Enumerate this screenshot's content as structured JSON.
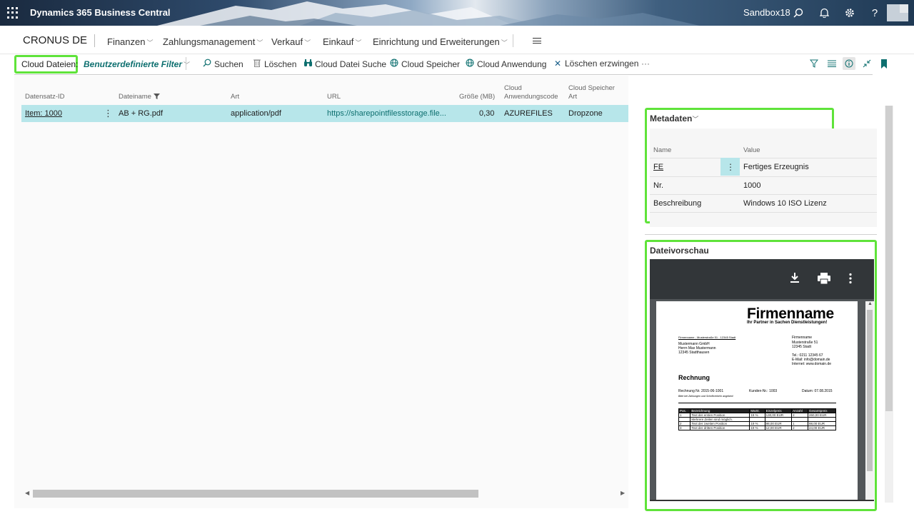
{
  "topbar": {
    "app_title": "Dynamics 365 Business Central",
    "environment": "Sandbox18",
    "icons": [
      "waffle-icon",
      "search-icon",
      "bell-icon",
      "gear-icon",
      "help-icon",
      "avatar"
    ]
  },
  "nav": {
    "company": "CRONUS DE",
    "items": [
      {
        "label": "Finanzen"
      },
      {
        "label": "Zahlungsmanagement"
      },
      {
        "label": "Verkauf"
      },
      {
        "label": "Einkauf"
      },
      {
        "label": "Einrichtung und Erweiterungen"
      }
    ]
  },
  "actionbar": {
    "title": "Cloud Dateien:",
    "filter": "Benutzerdefinierte Filter",
    "actions": [
      {
        "label": "Suchen",
        "icon": "search-icon"
      },
      {
        "label": "Löschen",
        "icon": "trash-icon"
      },
      {
        "label": "Cloud Datei Suche",
        "icon": "binoculars-icon"
      },
      {
        "label": "Cloud Speicher",
        "icon": "globe-icon"
      },
      {
        "label": "Cloud Anwendung",
        "icon": "globe-icon"
      },
      {
        "label": "Löschen erzwingen",
        "icon": "x-icon"
      }
    ],
    "more": "···"
  },
  "grid": {
    "columns": [
      {
        "label": "Datensatz-ID"
      },
      {
        "label": "Dateiname"
      },
      {
        "label": "Art"
      },
      {
        "label": "URL"
      },
      {
        "label": "Größe (MB)"
      },
      {
        "label": "Cloud\nAnwendungscode"
      },
      {
        "label": "Cloud Speicher\nArt"
      }
    ],
    "rows": [
      {
        "record_id": "Item: 1000",
        "filename": "AB + RG.pdf",
        "type": "application/pdf",
        "url": "https://sharepointfilesstorage.file...",
        "size": "0,30",
        "app_code": "AZUREFILES",
        "storage_type": "Dropzone"
      }
    ]
  },
  "metadata": {
    "title": "Metadaten",
    "headers": {
      "name": "Name",
      "value": "Value"
    },
    "rows": [
      {
        "name": "FE",
        "value": "Fertiges Erzeugnis"
      },
      {
        "name": "Nr.",
        "value": "1000"
      },
      {
        "name": "Beschreibung",
        "value": "Windows 10 ISO Lizenz"
      }
    ]
  },
  "preview": {
    "title": "Dateivorschau",
    "document": {
      "company": "Firmenname",
      "slogan": "Ihr Partner in Sachen Dienstleistungen!",
      "sender_line": "Firmenname - Musterstraße 51 - 12345 Stadt",
      "recipient": [
        "Mustermann GmbH",
        "Herrn Max Mustermann",
        "12345 Stadthausen"
      ],
      "company_block": [
        "Firmenname",
        "Musterstraße 51",
        "12345 Stadt",
        "",
        "Tel.: 0211 12345 67",
        "E-Mail: info@domain.de",
        "Internet: www.domain.de"
      ],
      "heading": "Rechnung",
      "invoice_no": "Rechnung Nr. 2015-06-1001",
      "customer_no": "Kunden-Nr.: 1003",
      "date": "Datum: 07.08.2015",
      "note": "Bitte bei Zahlungen und Schriftverkehr angeben!",
      "table_headers": [
        "Pos.",
        "Bezeichnung",
        "MwSt.",
        "Einzelpreis",
        "Anzahl",
        "Gesamtpreis"
      ],
      "table_rows": [
        [
          "1",
          "Text der ersten Position",
          "19 %",
          "130,00 EUR",
          "2",
          "260,00 EUR"
        ],
        [
          "",
          "Mehrere Zeilen sind möglich.",
          "",
          "",
          "",
          ""
        ],
        [
          "2",
          "Text der zweiten Position",
          "19 %",
          "98,00 EUR",
          "1",
          "98,00 EUR"
        ],
        [
          "3",
          "Text der dritten Position",
          "19 %",
          "12,00 EUR",
          "2",
          "24,00 EUR"
        ]
      ]
    }
  },
  "colors": {
    "accent": "#0d6f6f",
    "selection": "#b7e6ea",
    "highlight": "#5fe33a"
  }
}
